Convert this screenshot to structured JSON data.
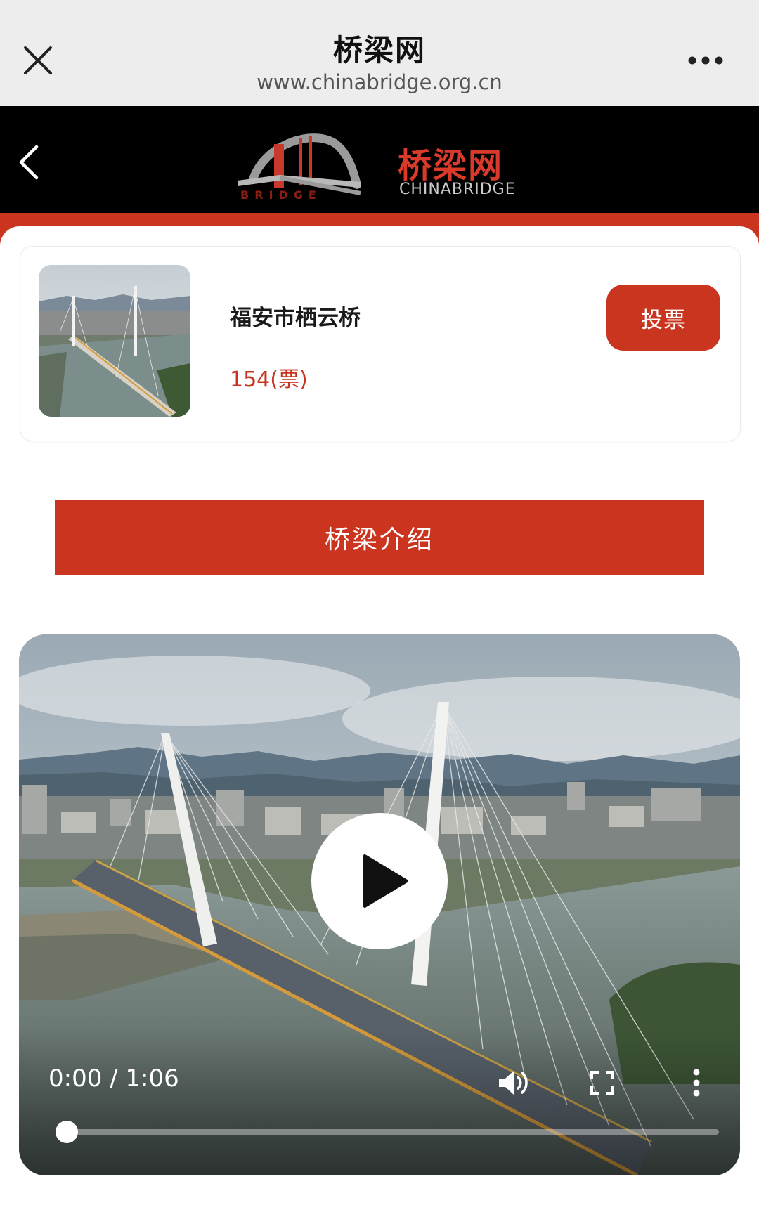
{
  "browser": {
    "title": "桥梁网",
    "url": "www.chinabridge.org.cn"
  },
  "site": {
    "logo_cn": "桥梁网",
    "logo_en": "CHINABRIDGE",
    "logo_badge": "BRIDGE"
  },
  "entry": {
    "name": "福安市栖云桥",
    "votes": "154(票)",
    "vote_label": "投票"
  },
  "intro_label": "桥梁介绍",
  "video": {
    "time": "0:00 / 1:06",
    "progress": 0
  },
  "colors": {
    "accent": "#cb3520",
    "header_bg": "#000000",
    "browser_bg": "#ededed"
  },
  "icons": [
    "close-icon",
    "more-icon",
    "back-icon",
    "play-icon",
    "volume-icon",
    "fullscreen-icon",
    "video-more-icon"
  ]
}
